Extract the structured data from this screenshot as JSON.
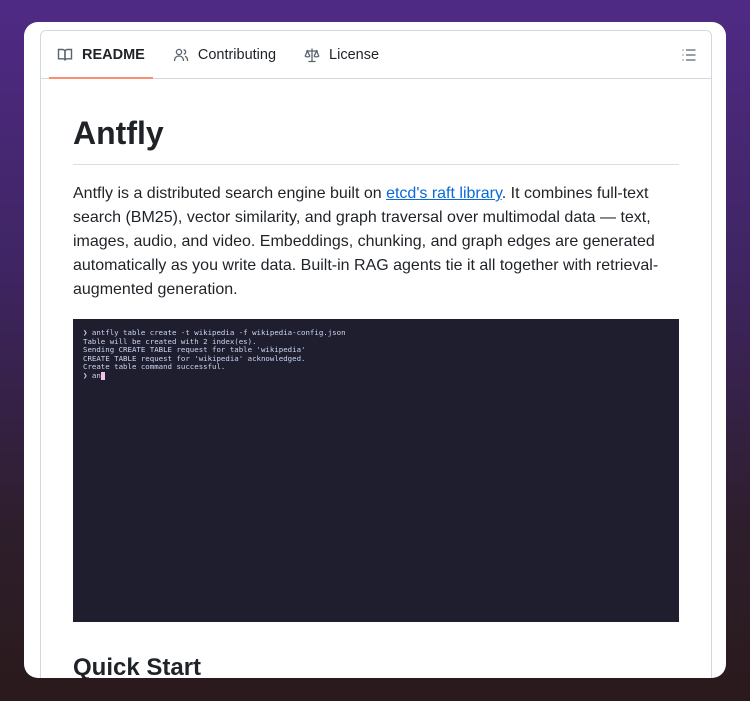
{
  "tabs": [
    {
      "label": "README",
      "icon": "book-icon",
      "active": true
    },
    {
      "label": "Contributing",
      "icon": "people-icon",
      "active": false
    },
    {
      "label": "License",
      "icon": "law-scale-icon",
      "active": false
    }
  ],
  "toc_icon": "list-icon",
  "readme": {
    "title": "Antfly",
    "intro_before_link": "Antfly is a distributed search engine built on ",
    "intro_link": "etcd's raft library",
    "intro_after_link": ". It combines full-text search (BM25), vector similarity, and graph traversal over multimodal data — text, images, audio, and video. Embeddings, chunking, and graph edges are generated automatically as you write data. Built-in RAG agents tie it all together with retrieval-augmented generation.",
    "terminal": {
      "lines": [
        "❯ antfly table create -t wikipedia -f wikipedia-config.json",
        "Table will be created with 2 index(es).",
        "Sending CREATE TABLE request for table 'wikipedia'",
        "CREATE TABLE request for 'wikipedia' acknowledged.",
        "Create table command successful."
      ],
      "prompt": "❯ an"
    },
    "quick_start_heading": "Quick Start"
  },
  "colors": {
    "active_tab_underline": "#fd8c73",
    "link": "#0969da",
    "terminal_bg": "#1e1e2e"
  }
}
